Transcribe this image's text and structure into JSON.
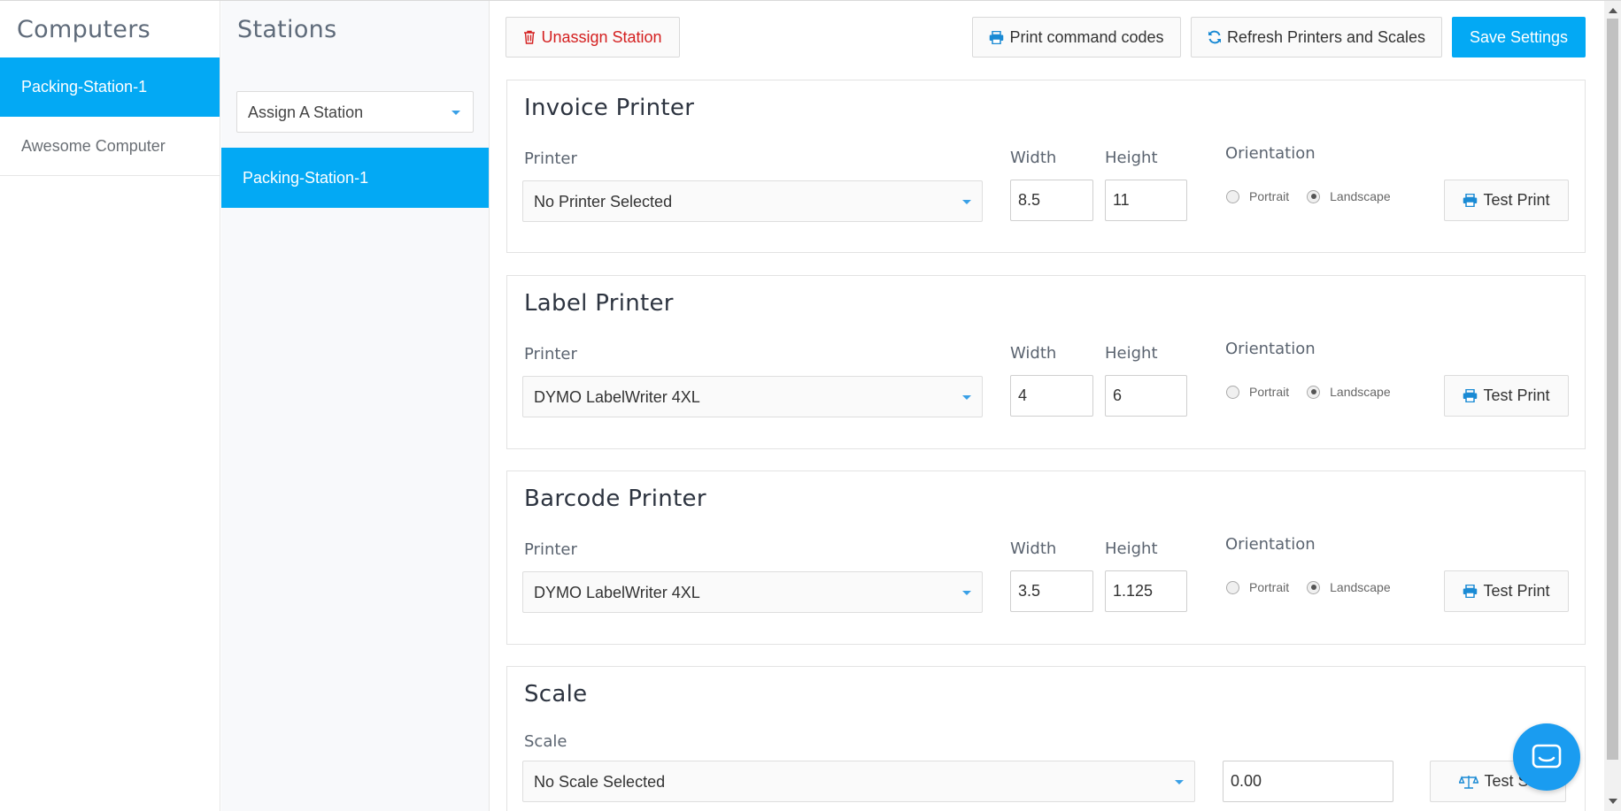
{
  "computers": {
    "title": "Computers",
    "items": [
      {
        "label": "Packing-Station-1",
        "active": true
      },
      {
        "label": "Awesome Computer",
        "active": false
      }
    ]
  },
  "stations": {
    "title": "Stations",
    "assign_select": "Assign A Station",
    "items": [
      {
        "label": "Packing-Station-1",
        "active": true
      }
    ]
  },
  "toolbar": {
    "unassign_label": "Unassign Station",
    "print_codes_label": "Print command codes",
    "refresh_label": "Refresh Printers and Scales",
    "save_label": "Save Settings"
  },
  "labels": {
    "printer": "Printer",
    "width": "Width",
    "height": "Height",
    "orientation": "Orientation",
    "portrait": "Portrait",
    "landscape": "Landscape",
    "test_print": "Test Print"
  },
  "invoice": {
    "title": "Invoice Printer",
    "printer": "No Printer Selected",
    "width": "8.5",
    "height": "11",
    "orientation": "Landscape"
  },
  "label": {
    "title": "Label Printer",
    "printer": "DYMO LabelWriter 4XL",
    "width": "4",
    "height": "6",
    "orientation": "Landscape"
  },
  "barcode": {
    "title": "Barcode Printer",
    "printer": "DYMO LabelWriter 4XL",
    "width": "3.5",
    "height": "1.125",
    "orientation": "Landscape"
  },
  "scale": {
    "title": "Scale",
    "label": "Scale",
    "select": "No Scale Selected",
    "value": "0.00",
    "test_label": "Test Sc"
  },
  "colors": {
    "accent": "#03a9f4",
    "danger": "#d42020",
    "chat": "#1a9cf0"
  },
  "icons": [
    "trash-icon",
    "printer-icon",
    "refresh-icon",
    "balance-scale-icon",
    "chat-icon",
    "chevron-down-icon"
  ]
}
